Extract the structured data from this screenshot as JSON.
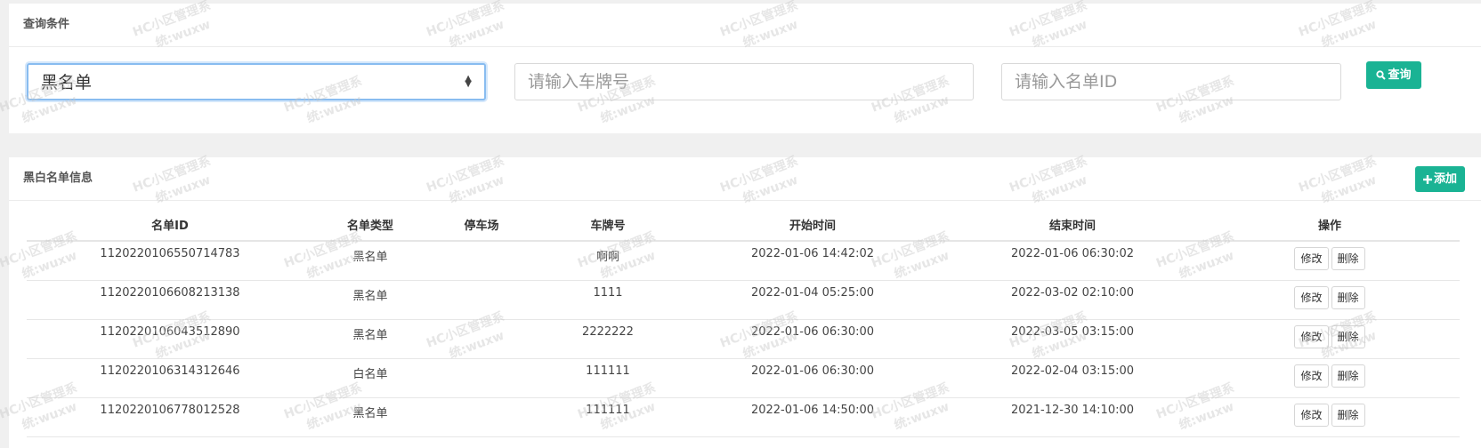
{
  "query_panel": {
    "title": "查询条件",
    "type_select": {
      "value": "黑名单"
    },
    "plate_input": {
      "placeholder": "请输入车牌号"
    },
    "id_input": {
      "placeholder": "请输入名单ID"
    },
    "search_button": {
      "label": "查询",
      "icon": "search-icon"
    }
  },
  "list_panel": {
    "title": "黑白名单信息",
    "add_button": {
      "label": "添加",
      "icon": "plus-icon"
    },
    "columns": [
      "名单ID",
      "名单类型",
      "停车场",
      "车牌号",
      "开始时间",
      "结束时间",
      "操作"
    ],
    "rows": [
      {
        "id": "1120220106550714783",
        "type": "黑名单",
        "lot": "",
        "plate": "啊啊",
        "start": "2022-01-06 14:42:02",
        "end": "2022-01-06 06:30:02"
      },
      {
        "id": "1120220106608213138",
        "type": "黑名单",
        "lot": "",
        "plate": "1111",
        "start": "2022-01-04 05:25:00",
        "end": "2022-03-02 02:10:00"
      },
      {
        "id": "1120220106043512890",
        "type": "黑名单",
        "lot": "",
        "plate": "2222222",
        "start": "2022-01-06 06:30:00",
        "end": "2022-03-05 03:15:00"
      },
      {
        "id": "1120220106314312646",
        "type": "白名单",
        "lot": "",
        "plate": "111111",
        "start": "2022-01-06 06:30:00",
        "end": "2022-02-04 03:15:00"
      },
      {
        "id": "1120220106778012528",
        "type": "黑名单",
        "lot": "",
        "plate": "111111",
        "start": "2022-01-06 14:50:00",
        "end": "2021-12-30 14:10:00"
      }
    ],
    "edit_label": "修改",
    "delete_label": "删除"
  },
  "watermark": {
    "line1": "HC小区管理系",
    "line2": "统:wuxw"
  },
  "colors": {
    "accent": "#1ab394",
    "focus_border": "#88bcf0"
  }
}
